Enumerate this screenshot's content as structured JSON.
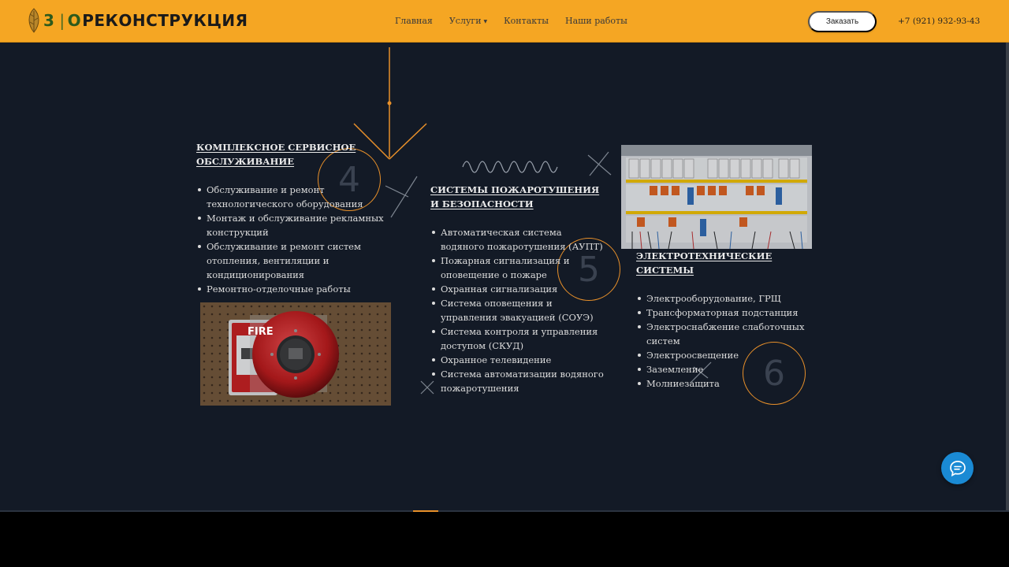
{
  "header": {
    "logo": {
      "prefix": "3",
      "separator": "|",
      "zero": "O",
      "name": "РЕКОНСТРУКЦИЯ"
    },
    "nav": [
      {
        "label": "Главная",
        "has_dropdown": false
      },
      {
        "label": "Услуги",
        "has_dropdown": true
      },
      {
        "label": "Контакты",
        "has_dropdown": false
      },
      {
        "label": "Наши работы",
        "has_dropdown": false
      }
    ],
    "order_button": "Заказать",
    "phone": "+7 (921) 932-93-43"
  },
  "colors": {
    "header_bg": "#f5a623",
    "page_bg": "#131a26",
    "accent": "#e8902a",
    "chat_button": "#1a8ad4"
  },
  "sections": [
    {
      "number": "4",
      "title": "КОМПЛЕКСНОЕ СЕРВИСНОЕ ОБСЛУЖИВАНИЕ",
      "items": [
        "Обслуживание и ремонт технологического оборудования",
        "Монтаж и обслуживание рекламных конструкций",
        "Обслуживание и ремонт систем отопления, вентиляции и кондиционирования",
        "Ремонтно-отделочные работы"
      ],
      "image": {
        "caption": "FIRE",
        "icon": "fire-alarm-photo"
      }
    },
    {
      "number": "5",
      "title": "СИСТЕМЫ ПОЖАРОТУШЕНИЯ И БЕЗОПАСНОСТИ",
      "items": [
        "Автоматическая система водяного пожаротушения (АУПТ)",
        "Пожарная сигнализация и оповещение о пожаре",
        "Охранная сигнализация",
        "Система оповещения и управления эвакуацией (СОУЭ)",
        "Система контроля и управления доступом (СКУД)",
        "Охранное телевидение",
        "Система автоматизации водяного пожаротушения"
      ]
    },
    {
      "number": "6",
      "title": "ЭЛЕКТРОТЕХНИЧЕСКИЕ СИСТЕМЫ",
      "items": [
        "Электрооборудование, ГРЩ",
        "Трансформаторная подстанция",
        "Электроснабжение слаботочных систем",
        "Электроосвещение",
        "Заземление",
        "Молниезащита"
      ],
      "image": {
        "icon": "electrical-panel-photo"
      }
    }
  ],
  "chat": {
    "icon": "chat-bubble-icon"
  }
}
